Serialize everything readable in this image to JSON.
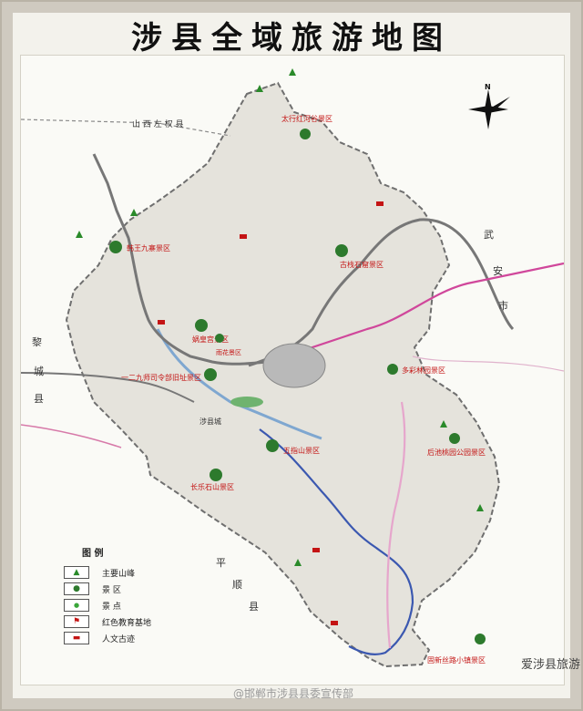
{
  "title": "涉县全域旅游地图",
  "compass": {
    "label": "N"
  },
  "neighbors": [
    {
      "text": "山 西 左 权 县"
    },
    {
      "text": "武"
    },
    {
      "text": "安"
    },
    {
      "text": "市"
    },
    {
      "text": "黎"
    },
    {
      "text": "城"
    },
    {
      "text": "县"
    },
    {
      "text": "平"
    },
    {
      "text": "顺"
    },
    {
      "text": "县"
    }
  ],
  "scenic_areas": [
    {
      "name": "太行红河谷景区"
    },
    {
      "name": "韩王九寨景区"
    },
    {
      "name": "一二九师司令部旧址景区"
    },
    {
      "name": "娲皇宫景区"
    },
    {
      "name": "多彩林园景区"
    },
    {
      "name": "古栈石窟景区"
    },
    {
      "name": "长乐石山景区"
    },
    {
      "name": "五指山景区"
    },
    {
      "name": "雨花景区"
    },
    {
      "name": "后池桃园公园景区"
    },
    {
      "name": "固新丝路小镇景区"
    },
    {
      "name": "涉县城"
    }
  ],
  "legend": {
    "heading": "图  例",
    "items": [
      {
        "label": "主要山峰",
        "icon": "mountain-icon"
      },
      {
        "label": "景 区",
        "icon": "scenic-area-icon"
      },
      {
        "label": "景 点",
        "icon": "attraction-dot-icon"
      },
      {
        "label": "红色教育基地",
        "icon": "red-flag-icon"
      },
      {
        "label": "人文古迹",
        "icon": "heritage-icon"
      }
    ]
  },
  "watermarks": {
    "account": "爱涉县旅游",
    "weibo": "@邯郸市涉县县委宣传部"
  },
  "colors": {
    "scenic": "#2d7a2d",
    "attraction": "#3aa63a",
    "red_base": "#c41414",
    "highway": "#777777",
    "railway": "#3b58b0",
    "expressway": "#d0479b",
    "boundary": "#6f6f6f"
  }
}
